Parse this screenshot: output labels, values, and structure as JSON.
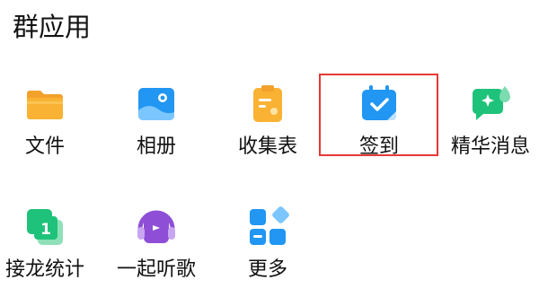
{
  "section": {
    "title": "群应用"
  },
  "apps": [
    {
      "label": "文件",
      "icon": "folder-icon",
      "color": "#F9B233"
    },
    {
      "label": "相册",
      "icon": "photo-album-icon",
      "color": "#2196F3"
    },
    {
      "label": "收集表",
      "icon": "clipboard-form-icon",
      "color": "#F9B233"
    },
    {
      "label": "签到",
      "icon": "calendar-check-icon",
      "color": "#2196F3",
      "highlighted": true
    },
    {
      "label": "精华消息",
      "icon": "sparkle-chat-icon",
      "color": "#1FC27A"
    },
    {
      "label": "接龙统计",
      "icon": "relay-cards-icon",
      "color": "#1FC27A"
    },
    {
      "label": "一起听歌",
      "icon": "headphones-music-icon",
      "color": "#8E4FD6"
    },
    {
      "label": "更多",
      "icon": "more-apps-grid-icon",
      "color": "#2196F3"
    }
  ],
  "colors": {
    "highlight_border": "#E53935"
  }
}
